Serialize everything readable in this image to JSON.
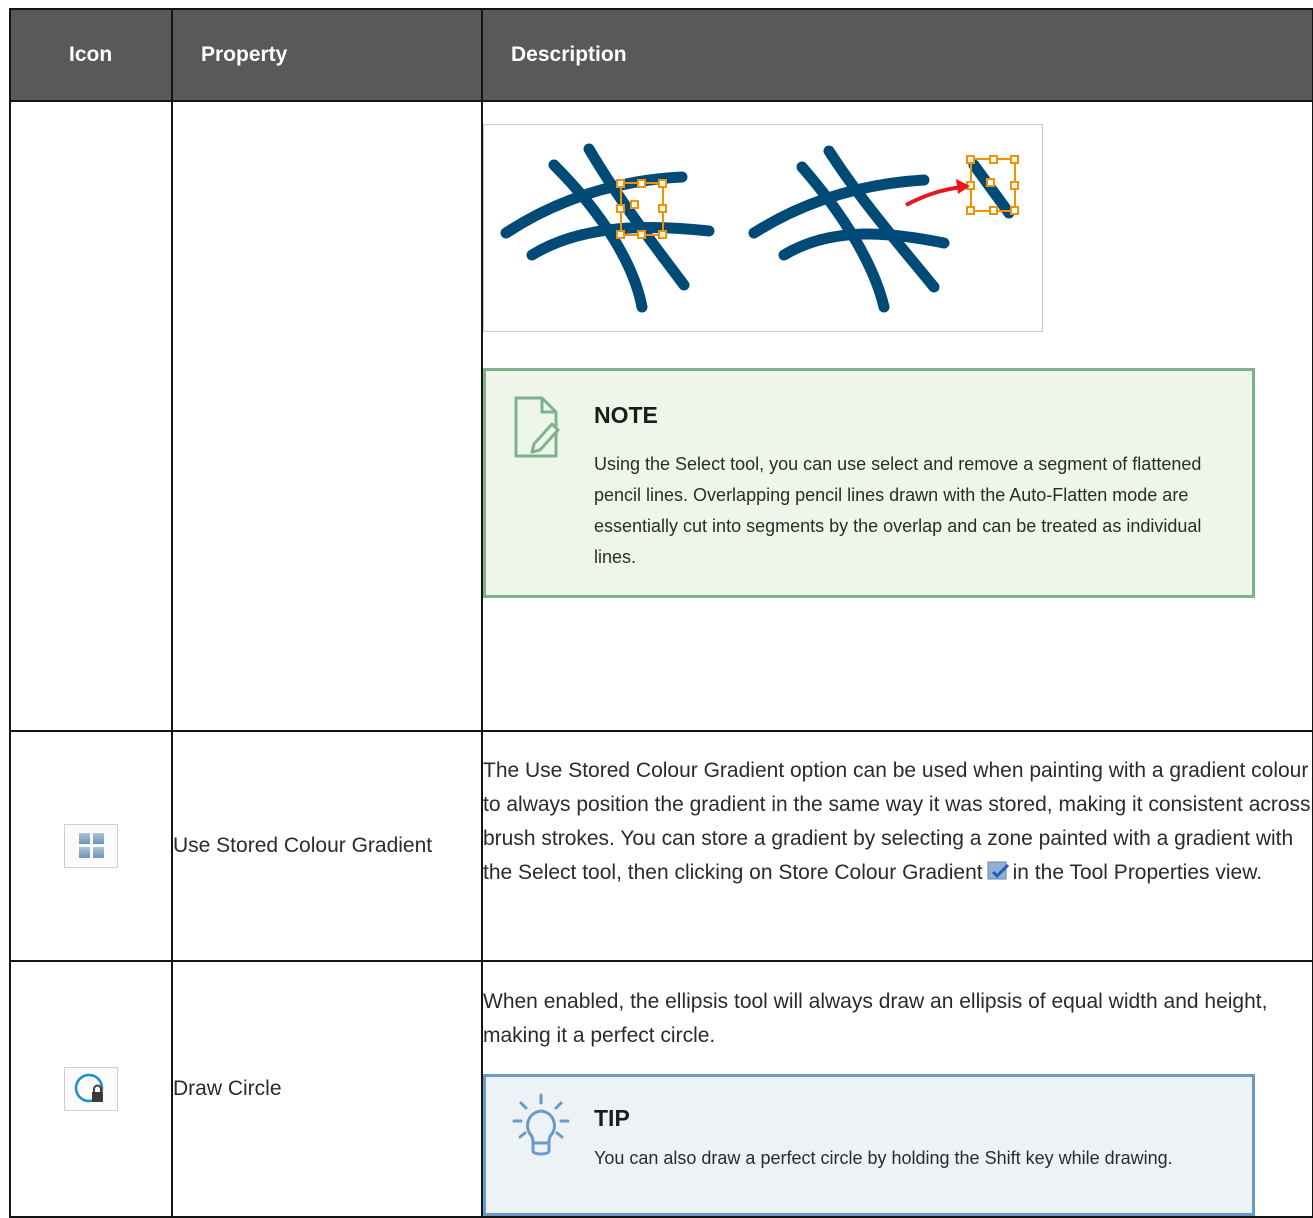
{
  "table": {
    "headers": {
      "icon": "Icon",
      "property": "Property",
      "description": "Description"
    },
    "rows": [
      {
        "property": "",
        "note": {
          "title": "NOTE",
          "text": "Using the Select tool, you can use select and remove a segment of flattened pencil lines. Overlapping pencil lines drawn with the Auto-Flatten mode are essentially cut into segments by the overlap and can be treated as individual lines."
        }
      },
      {
        "icon_name": "use-stored-colour-gradient-icon",
        "property": "Use Stored Colour Gradient",
        "description_before": "The Use Stored Colour Gradient option can be used when painting with a gradient colour to always position the gradient in the same way it was stored, making it consistent across brush strokes. You can store a gradient by selecting a zone painted with a gradient with the Select tool, then clicking on Store Colour Gradient",
        "description_after": "in the Tool Properties view."
      },
      {
        "icon_name": "draw-circle-icon",
        "property": "Draw Circle",
        "description": "When enabled, the ellipsis tool will always draw an ellipsis of equal width and height, making it a perfect circle.",
        "tip": {
          "title": "TIP",
          "text": "You can also draw a perfect circle by holding the Shift key while drawing."
        }
      }
    ]
  },
  "colors": {
    "header_bg": "#595959",
    "stroke": "#004a78",
    "selection": "#f39200",
    "arrow": "#e8171c",
    "note_border": "#7fb28c",
    "note_bg": "#eef6ea",
    "tip_border": "#6b9ac6",
    "tip_bg": "#edf2f7"
  }
}
